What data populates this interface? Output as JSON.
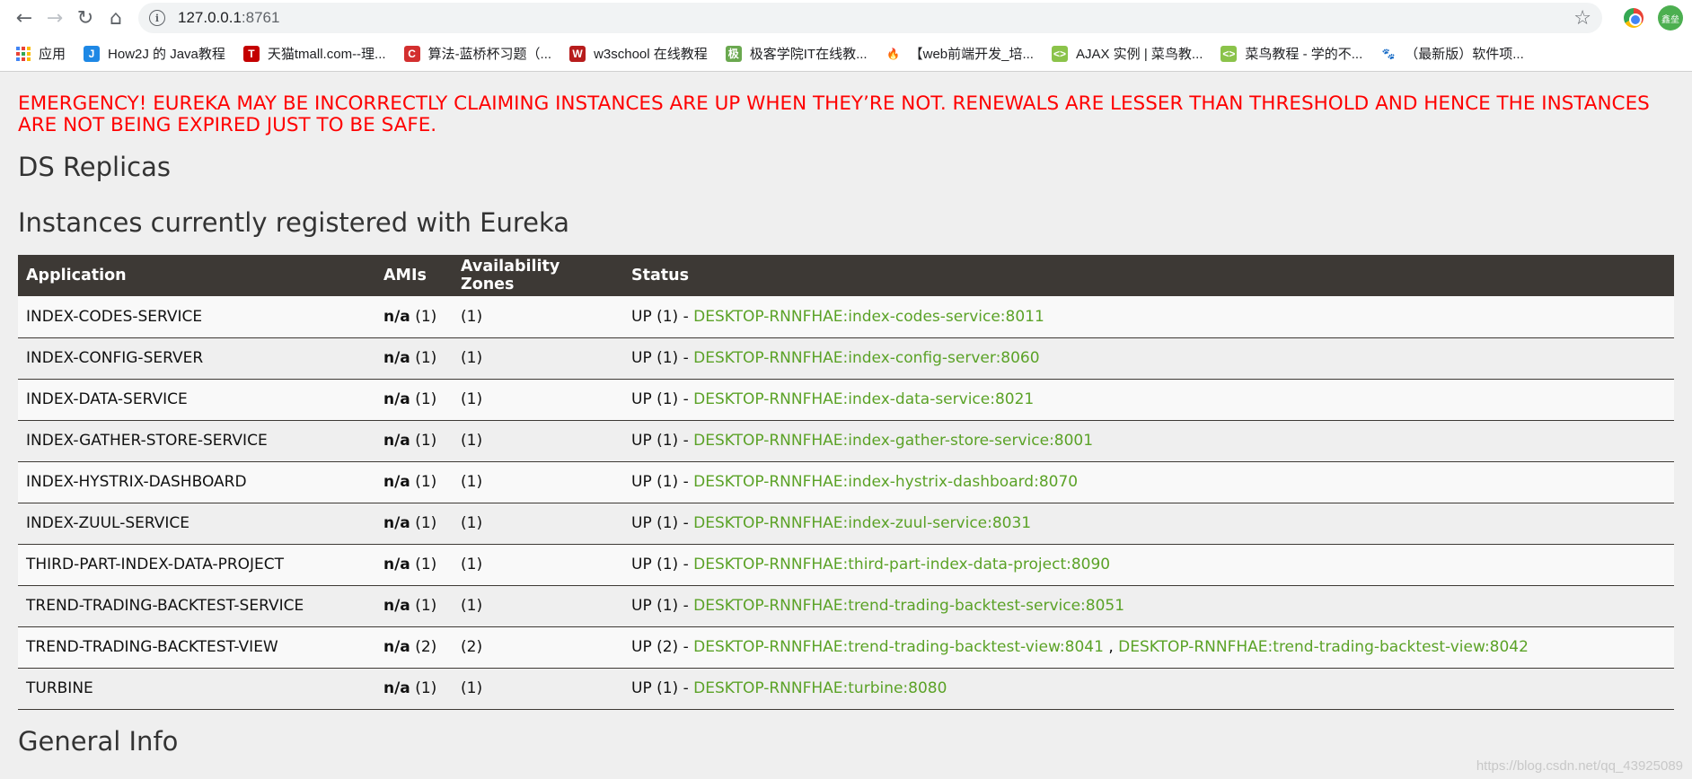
{
  "browser": {
    "url_host": "127.0.0.1",
    "url_port": ":8761",
    "avatar_text": "鑫垒"
  },
  "bookmarks": [
    {
      "label": "应用",
      "icon": "apps-grid-icon"
    },
    {
      "label": "How2J 的 Java教程",
      "icon": "how2j-icon",
      "color": "#1e88e5",
      "glyph": "J"
    },
    {
      "label": "天猫tmall.com--理...",
      "icon": "tmall-icon",
      "color": "#c40000",
      "glyph": "T"
    },
    {
      "label": "算法-蓝桥杯习题（...",
      "icon": "lanqiao-icon",
      "color": "#d32f2f",
      "glyph": "C"
    },
    {
      "label": "w3school 在线教程",
      "icon": "w3school-icon",
      "color": "#b71c1c",
      "glyph": "W"
    },
    {
      "label": "极客学院IT在线教...",
      "icon": "jikexueyuan-icon",
      "color": "#6aa84f",
      "glyph": "极"
    },
    {
      "label": "【web前端开发_培...",
      "icon": "fire-icon",
      "color": "#ffffff",
      "glyph": "🔥"
    },
    {
      "label": "AJAX 实例 | 菜鸟教...",
      "icon": "runoob-icon",
      "color": "#8bc34a",
      "glyph": "<>"
    },
    {
      "label": "菜鸟教程 - 学的不...",
      "icon": "runoob-icon",
      "color": "#8bc34a",
      "glyph": "<>"
    },
    {
      "label": "（最新版）软件项...",
      "icon": "baidu-paw-icon",
      "color": "#ffffff",
      "glyph": "🐾"
    }
  ],
  "page": {
    "emergency": "EMERGENCY! EUREKA MAY BE INCORRECTLY CLAIMING INSTANCES ARE UP WHEN THEY’RE NOT. RENEWALS ARE LESSER THAN THRESHOLD AND HENCE THE INSTANCES ARE NOT BEING EXPIRED JUST TO BE SAFE.",
    "ds_replicas": "DS Replicas",
    "instances_title": "Instances currently registered with Eureka",
    "general_info": "General Info",
    "watermark": "https://blog.csdn.net/qq_43925089"
  },
  "table": {
    "headers": [
      "Application",
      "AMIs",
      "Availability Zones",
      "Status"
    ],
    "rows": [
      {
        "app": "INDEX-CODES-SERVICE",
        "amis_na": "n/a",
        "amis_count": "(1)",
        "zones": "(1)",
        "status": "UP (1) - ",
        "links": [
          "DESKTOP-RNNFHAE:index-codes-service:8011"
        ]
      },
      {
        "app": "INDEX-CONFIG-SERVER",
        "amis_na": "n/a",
        "amis_count": "(1)",
        "zones": "(1)",
        "status": "UP (1) - ",
        "links": [
          "DESKTOP-RNNFHAE:index-config-server:8060"
        ]
      },
      {
        "app": "INDEX-DATA-SERVICE",
        "amis_na": "n/a",
        "amis_count": "(1)",
        "zones": "(1)",
        "status": "UP (1) - ",
        "links": [
          "DESKTOP-RNNFHAE:index-data-service:8021"
        ]
      },
      {
        "app": "INDEX-GATHER-STORE-SERVICE",
        "amis_na": "n/a",
        "amis_count": "(1)",
        "zones": "(1)",
        "status": "UP (1) - ",
        "links": [
          "DESKTOP-RNNFHAE:index-gather-store-service:8001"
        ]
      },
      {
        "app": "INDEX-HYSTRIX-DASHBOARD",
        "amis_na": "n/a",
        "amis_count": "(1)",
        "zones": "(1)",
        "status": "UP (1) - ",
        "links": [
          "DESKTOP-RNNFHAE:index-hystrix-dashboard:8070"
        ]
      },
      {
        "app": "INDEX-ZUUL-SERVICE",
        "amis_na": "n/a",
        "amis_count": "(1)",
        "zones": "(1)",
        "status": "UP (1) - ",
        "links": [
          "DESKTOP-RNNFHAE:index-zuul-service:8031"
        ]
      },
      {
        "app": "THIRD-PART-INDEX-DATA-PROJECT",
        "amis_na": "n/a",
        "amis_count": "(1)",
        "zones": "(1)",
        "status": "UP (1) - ",
        "links": [
          "DESKTOP-RNNFHAE:third-part-index-data-project:8090"
        ]
      },
      {
        "app": "TREND-TRADING-BACKTEST-SERVICE",
        "amis_na": "n/a",
        "amis_count": "(1)",
        "zones": "(1)",
        "status": "UP (1) - ",
        "links": [
          "DESKTOP-RNNFHAE:trend-trading-backtest-service:8051"
        ]
      },
      {
        "app": "TREND-TRADING-BACKTEST-VIEW",
        "amis_na": "n/a",
        "amis_count": "(2)",
        "zones": "(2)",
        "status": "UP (2) - ",
        "links": [
          "DESKTOP-RNNFHAE:trend-trading-backtest-view:8041",
          "DESKTOP-RNNFHAE:trend-trading-backtest-view:8042"
        ]
      },
      {
        "app": "TURBINE",
        "amis_na": "n/a",
        "amis_count": "(1)",
        "zones": "(1)",
        "status": "UP (1) - ",
        "links": [
          "DESKTOP-RNNFHAE:turbine:8080"
        ]
      }
    ]
  },
  "colors": {
    "emergency": "#ff0000",
    "link": "#5ba227",
    "table_header": "#3d3935"
  }
}
